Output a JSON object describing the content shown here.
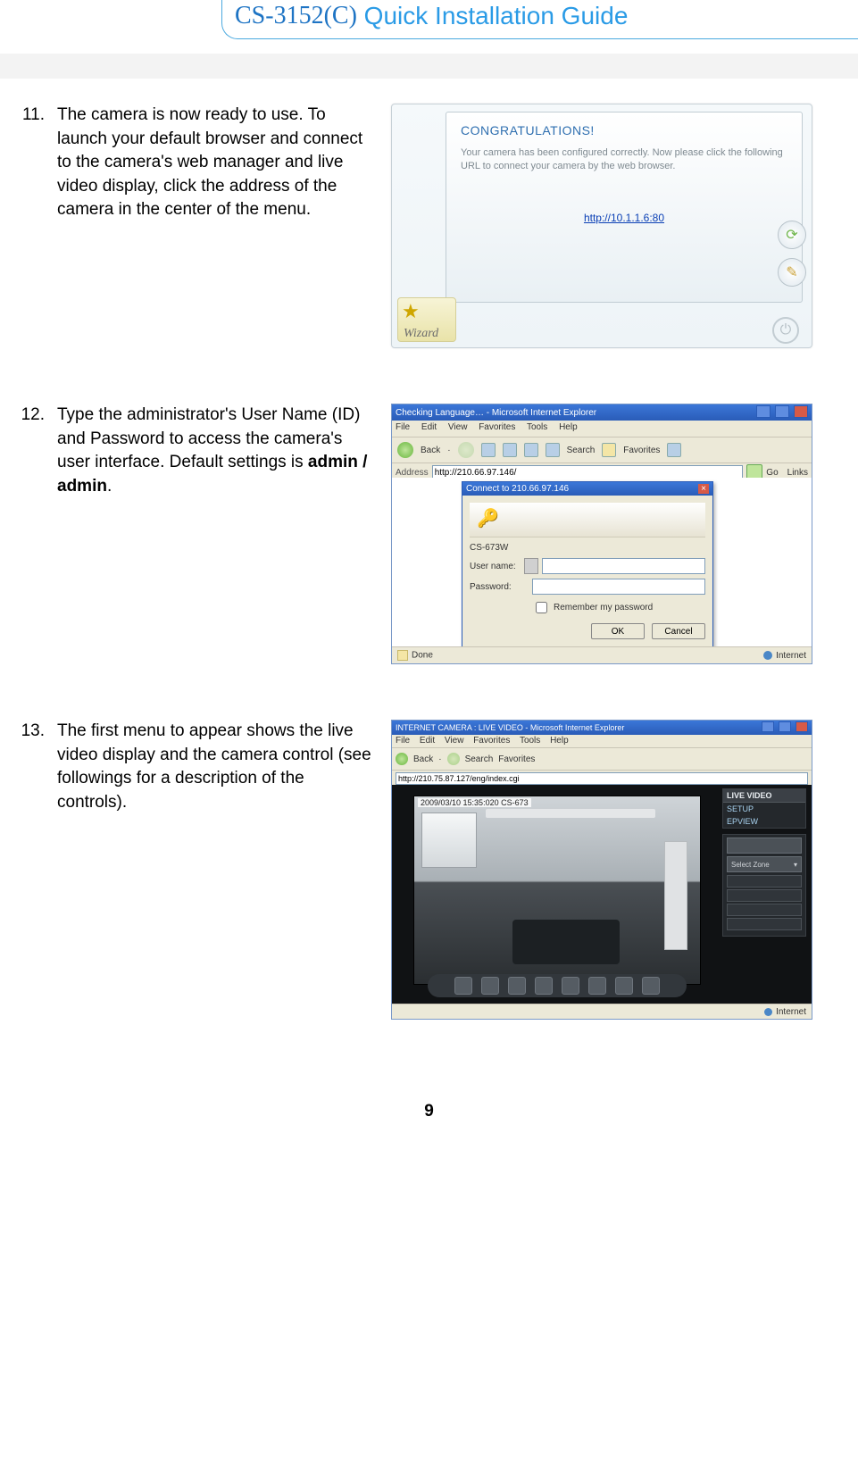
{
  "header": {
    "model": "CS-3152(C)",
    "rest": " Quick Installation Guide"
  },
  "steps": {
    "s11": {
      "num": "11.",
      "text": "The camera is now ready to use. To launch your default browser and connect to the camera's web manager and live video display, click the address of the camera in the center of the menu."
    },
    "s12": {
      "num": "12.",
      "text_before": "Type the administrator's User Name (ID) and Password to access the camera's user interface. Default settings is ",
      "text_bold": "admin / admin",
      "text_after": "."
    },
    "s13": {
      "num": "13.",
      "text": "The first menu to appear shows the live video display and the camera control (see followings for a description of the controls)."
    }
  },
  "fig11": {
    "congr": "CONGRATULATIONS!",
    "sub": "Your camera has been configured correctly. Now please click the following URL to connect your camera by the web browser.",
    "url": "http://10.1.1.6:80",
    "wizard": "Wizard"
  },
  "fig12": {
    "title": "Checking Language… - Microsoft Internet Explorer",
    "menu": {
      "file": "File",
      "edit": "Edit",
      "view": "View",
      "fav": "Favorites",
      "tools": "Tools",
      "help": "Help"
    },
    "tb": {
      "back": "Back",
      "search": "Search",
      "favorites": "Favorites"
    },
    "addr_label": "Address",
    "addr_value": "http://210.66.97.146/",
    "go": "Go",
    "links": "Links",
    "dialog": {
      "title": "Connect to 210.66.97.146",
      "realm": "CS-673W",
      "user_label": "User name:",
      "pass_label": "Password:",
      "remember": "Remember my password",
      "ok": "OK",
      "cancel": "Cancel"
    },
    "status_done": "Done",
    "status_net": "Internet"
  },
  "fig13": {
    "title": "INTERNET CAMERA : LIVE VIDEO - Microsoft Internet Explorer",
    "menu": {
      "file": "File",
      "edit": "Edit",
      "view": "View",
      "fav": "Favorites",
      "tools": "Tools",
      "help": "Help"
    },
    "tb": {
      "back": "Back",
      "search": "Search",
      "favorites": "Favorites"
    },
    "addr_value": "http://210.75.87.127/eng/index.cgi",
    "overlay": "2009/03/10 15:35:020 CS-673",
    "side": {
      "hdr": "LIVE VIDEO",
      "setup": "SETUP",
      "epview": "EPVIEW",
      "select": "Select Zone"
    },
    "status_net": "Internet"
  },
  "page_number": "9"
}
